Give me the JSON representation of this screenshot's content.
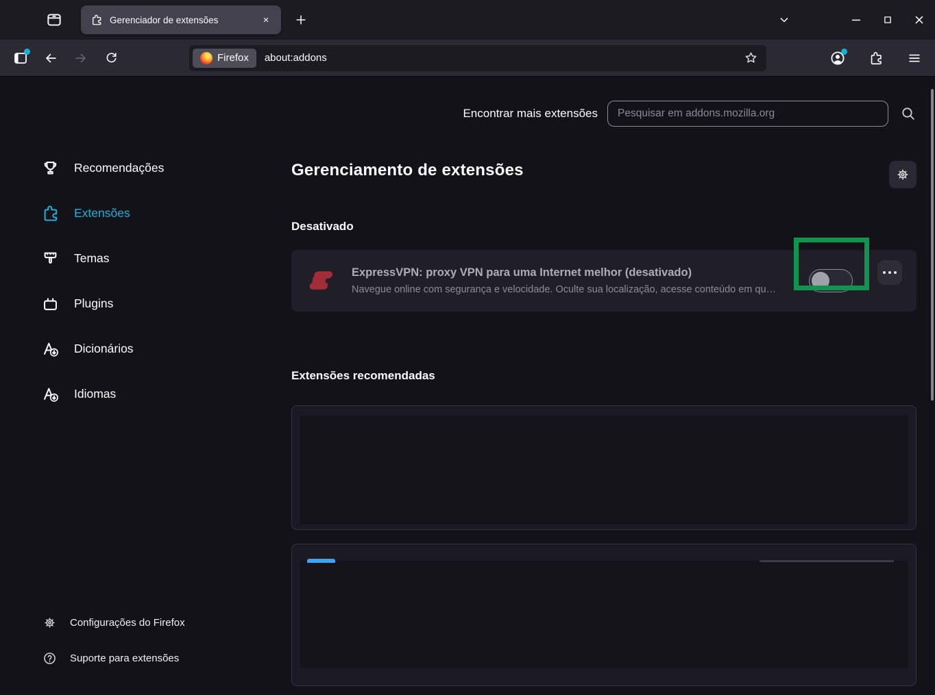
{
  "window": {
    "tab": {
      "title": "Gerenciador de extensões"
    },
    "url_bar": {
      "chip": "Firefox",
      "url": "about:addons"
    }
  },
  "search": {
    "label": "Encontrar mais extensões",
    "placeholder": "Pesquisar em addons.mozilla.org",
    "value": ""
  },
  "sidebar": {
    "items": [
      {
        "label": "Recomendações",
        "icon": "trophy",
        "selected": false
      },
      {
        "label": "Extensões",
        "icon": "puzzle",
        "selected": true
      },
      {
        "label": "Temas",
        "icon": "paintbrush",
        "selected": false
      },
      {
        "label": "Plugins",
        "icon": "plug",
        "selected": false
      },
      {
        "label": "Dicionários",
        "icon": "language-download",
        "selected": false
      },
      {
        "label": "Idiomas",
        "icon": "language-download",
        "selected": false
      }
    ],
    "footer": [
      {
        "label": "Configurações do Firefox",
        "icon": "gear"
      },
      {
        "label": "Suporte para extensões",
        "icon": "question-circle"
      }
    ]
  },
  "main": {
    "title": "Gerenciamento de extensões",
    "disabled_heading": "Desativado",
    "recommended_heading": "Extensões recomendadas",
    "extension": {
      "name": "ExpressVPN: proxy VPN para uma Internet melhor (desativado)",
      "description": "Navegue online com segurança e velocidade. Oculte sua localização, acesse conteúdo em qu…",
      "toggle_state": "off"
    }
  },
  "colors": {
    "accent_teal": "#1cb0d3",
    "annotation_green": "#0e9650",
    "expressvpn_red": "#a12d39"
  }
}
